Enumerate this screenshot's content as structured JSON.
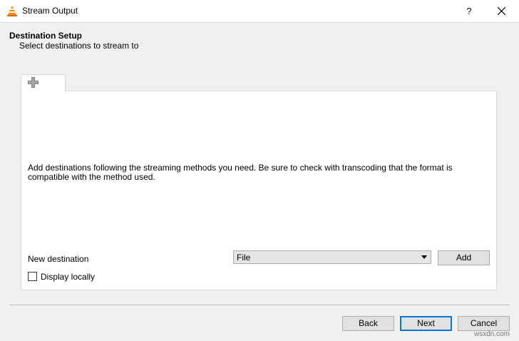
{
  "window": {
    "title": "Stream Output",
    "help_label": "?",
    "icons": {
      "app": "vlc-cone-icon",
      "close": "close-icon",
      "add_tab": "plus-icon"
    }
  },
  "header": {
    "title": "Destination Setup",
    "subtitle": "Select destinations to stream to"
  },
  "panel": {
    "description": "Add destinations following the streaming methods you need. Be sure to check with transcoding that the format is compatible with the method used.",
    "new_destination_label": "New destination",
    "destination_select": {
      "value": "File"
    },
    "add_button": "Add",
    "display_locally": {
      "label": "Display locally",
      "checked": false
    }
  },
  "footer": {
    "back_label": "Back",
    "next_label": "Next",
    "cancel_label": "Cancel"
  },
  "watermark": "wsxdn.com",
  "colors": {
    "accent": "#0078d7",
    "vlc_orange": "#ff8800"
  }
}
